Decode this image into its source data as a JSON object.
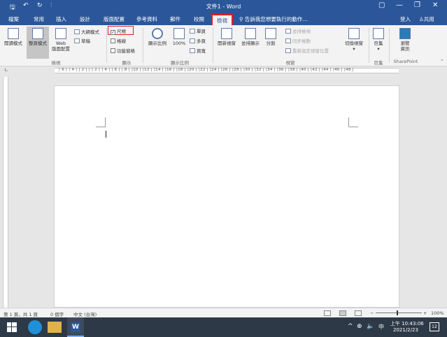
{
  "window": {
    "title": "文件1 - Word",
    "qat_save": "🖫",
    "qat_undo": "↶",
    "qat_redo": "↻",
    "qat_more": "⫶",
    "minimize": "—",
    "maximize": "❐",
    "restore": "▢",
    "close": "✕"
  },
  "tabs": {
    "file": "檔案",
    "home": "常用",
    "insert": "插入",
    "design": "設計",
    "layout": "版面配置",
    "references": "參考資料",
    "mailings": "郵件",
    "review": "校閱",
    "view": "檢視"
  },
  "tellme": "告訴我您想要執行的動作...",
  "signin": "登入",
  "share": "共用",
  "ribbon": {
    "views": {
      "read_mode": "閱讀模式",
      "print_layout": "整頁模式",
      "web_layout_1": "Web",
      "web_layout_2": "版面配置",
      "outline": "大綱模式",
      "draft": "草稿",
      "group": "檢視"
    },
    "show": {
      "ruler": "尺規",
      "ruler_checked": "✓",
      "gridlines": "格線",
      "nav_pane": "功能窗格",
      "group": "顯示"
    },
    "zoom": {
      "zoom": "顯示比例",
      "hundred": "100%",
      "one_page": "單頁",
      "multi_page": "多頁",
      "page_width": "頁寬",
      "group": "顯示比例"
    },
    "window": {
      "new_window": "開新視窗",
      "arrange_all": "並排顯示",
      "split": "分割",
      "side_by_side": "並排檢視",
      "sync_scroll": "同步捲動",
      "reset_pos": "重新設定視窗位置",
      "switch_windows": "切換視窗",
      "group": "視窗"
    },
    "macros": {
      "label": "巨集",
      "group": "巨集"
    },
    "sharepoint": {
      "label_1": "瀏覽",
      "label_2": "資訊",
      "group": "SharePoint"
    }
  },
  "ruler_numbers": "| 6 |   | 4 |   | 2 |   |   | 2 |   | 4 |   | 6 |   | 8 |  |10 |  |12 |  |14 |  |16 |  |18 |  |20 |  |22 |  |24 |  |26 |  |28 |  |30 |  |32 |  |34 |  |36 |  |38 |  |40 |  |42 |  |44 |  |46 |  |48 |",
  "status": {
    "page": "第 1 頁，共 1 頁",
    "words": "0 個字",
    "language": "中文 (台灣)",
    "zoom_minus": "−",
    "zoom_plus": "+",
    "zoom_pct": "100%"
  },
  "taskbar": {
    "time": "上午 10:43:06",
    "date": "2021/2/23",
    "ime": "中",
    "up_arrow": "^",
    "notif_count": "12"
  }
}
